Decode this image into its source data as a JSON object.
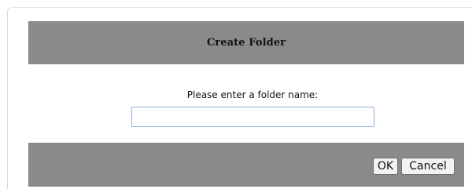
{
  "dialog": {
    "title": "Create Folder",
    "prompt": "Please enter a folder name:",
    "input": {
      "value": "",
      "placeholder": ""
    },
    "buttons": {
      "ok_label": "OK",
      "cancel_label": "Cancel"
    },
    "colors": {
      "header_bg": "#8a8a8a",
      "footer_bg": "#8a8a8a",
      "input_border": "#8fb3d9"
    }
  }
}
